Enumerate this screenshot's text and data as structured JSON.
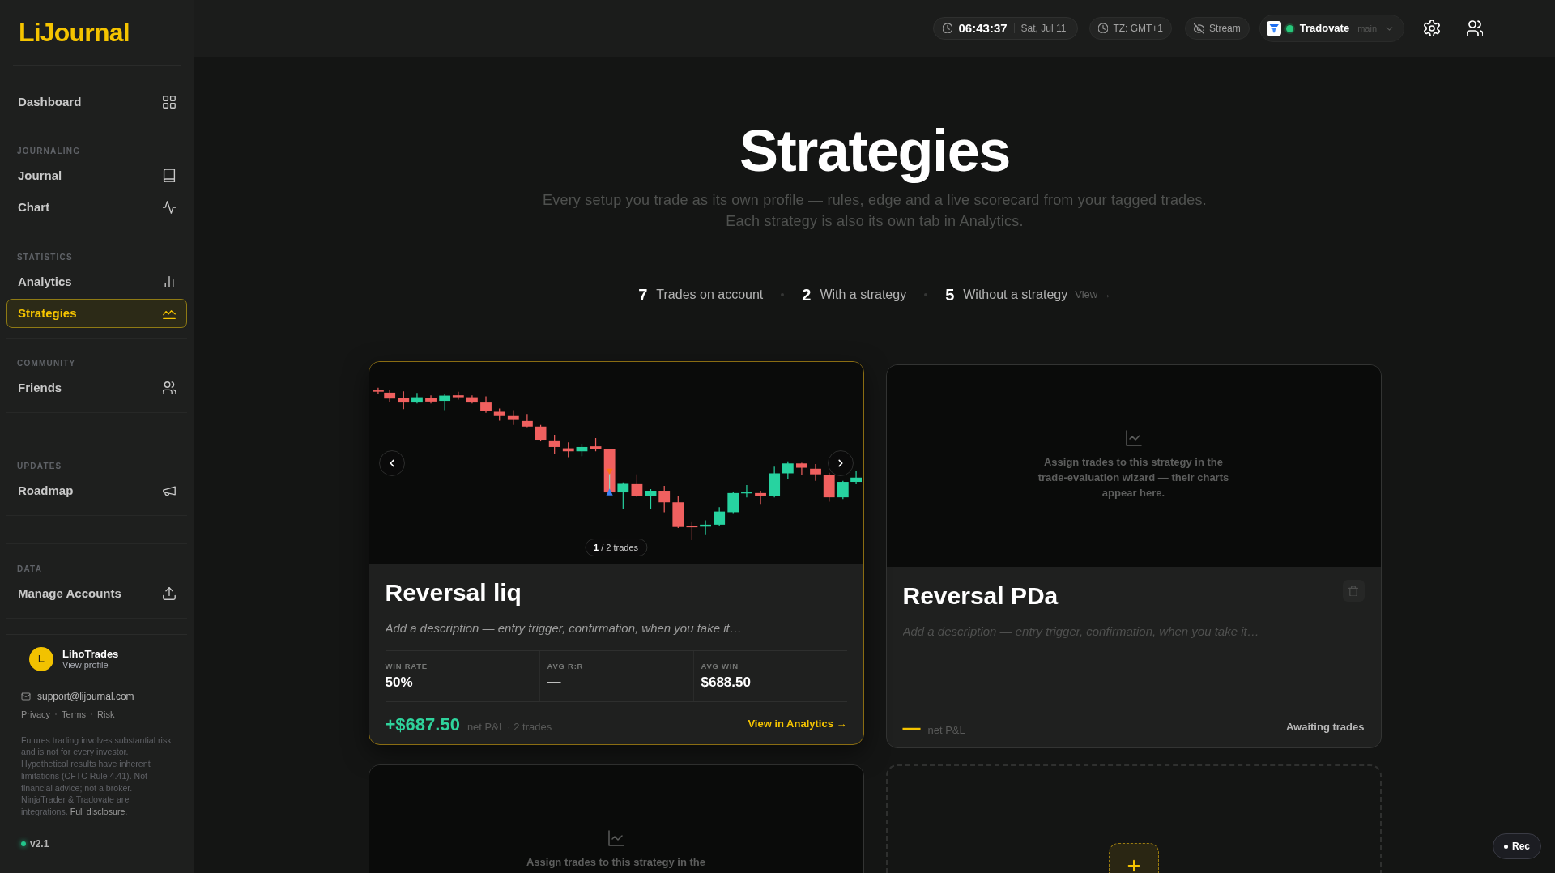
{
  "sidebar": {
    "logo": "LiJournal",
    "sections": [
      {
        "items": [
          {
            "label": "Dashboard",
            "selected": false
          }
        ]
      },
      {
        "title": "JOURNALING",
        "items": [
          {
            "label": "Journal",
            "selected": false
          },
          {
            "label": "Chart",
            "selected": false
          }
        ]
      },
      {
        "title": "STATISTICS",
        "items": [
          {
            "label": "Analytics",
            "selected": false
          },
          {
            "label": "Strategies",
            "selected": true
          }
        ]
      },
      {
        "title": "COMMUNITY",
        "items": [
          {
            "label": "Friends",
            "selected": false
          }
        ]
      },
      {
        "title": "UPDATES",
        "items": [
          {
            "label": "Roadmap",
            "selected": false
          }
        ]
      },
      {
        "title": "DATA",
        "items": [
          {
            "label": "Manage Accounts",
            "selected": false
          }
        ]
      }
    ],
    "profile": {
      "initial": "L",
      "name": "LihoTrades",
      "link": "View profile"
    },
    "email": "support@lijournal.com",
    "links": [
      "Privacy",
      "Terms",
      "Risk"
    ],
    "disclaimer": {
      "text": "Futures trading involves substantial risk and is not for every investor. Hypothetical results have inherent limitations (CFTC Rule 4.41). Not financial advice; not a broker. NinjaTrader & Tradovate are integrations.",
      "link": "Full disclosure",
      "end": "."
    },
    "version": "v2.1"
  },
  "topbar": {
    "time": "06:43:37",
    "date": "Sat, Jul 11",
    "timezone": "TZ: GMT+1",
    "stream": {
      "label": "Stream",
      "visible": false
    },
    "account": {
      "broker": "Tradovate",
      "name": "main",
      "connected": true
    }
  },
  "page": {
    "title": "Strategies",
    "subtitle": "Every setup you trade as its own profile — rules, edge and a live scorecard from your tagged trades. Each strategy is also its own tab in Analytics.",
    "stats": [
      {
        "value": "7",
        "label": "Trades on account"
      },
      {
        "value": "2",
        "label": "With a strategy"
      },
      {
        "value": "5",
        "label": "Without a strategy",
        "link": "View →"
      }
    ]
  },
  "strategies": [
    {
      "kind": "strategy",
      "highlighted": true,
      "preview": {
        "kind": "trades",
        "counter": "**1** / 2 trades"
      },
      "name": "Reversal liq",
      "description": {
        "placeholder": "Add a description — entry trigger, confirmation, when you take it…"
      },
      "delete_button": false,
      "stats": [
        {
          "label": "WIN RATE",
          "value": "50%"
        },
        {
          "label": "AVG R:R",
          "value": "—"
        },
        {
          "label": "AVG WIN",
          "value": "$688.50"
        }
      ],
      "pnl": {
        "value": "+$687.50",
        "color": "#2fd39c",
        "caption": "net P&L · 2 trades"
      },
      "action": {
        "kind": "link",
        "label": "View in Analytics →"
      }
    },
    {
      "kind": "strategy",
      "highlighted": false,
      "preview": {
        "kind": "empty",
        "message": "Assign trades to this strategy in the trade-evaluation wizard — their charts appear here."
      },
      "name": "Reversal PDa",
      "description": {
        "placeholder": "Add a description — entry trigger, confirmation, when you take it…"
      },
      "delete_button": true,
      "pnl": {
        "value": "—",
        "color": "#f5c400",
        "caption": "net P&L"
      },
      "action": {
        "kind": "status",
        "label": "Awaiting trades"
      }
    },
    {
      "kind": "strategy",
      "highlighted": false,
      "preview": {
        "kind": "empty",
        "message": "Assign trades to this strategy in the"
      }
    },
    {
      "kind": "add"
    }
  ],
  "rec_button": {
    "label": "Rec"
  }
}
